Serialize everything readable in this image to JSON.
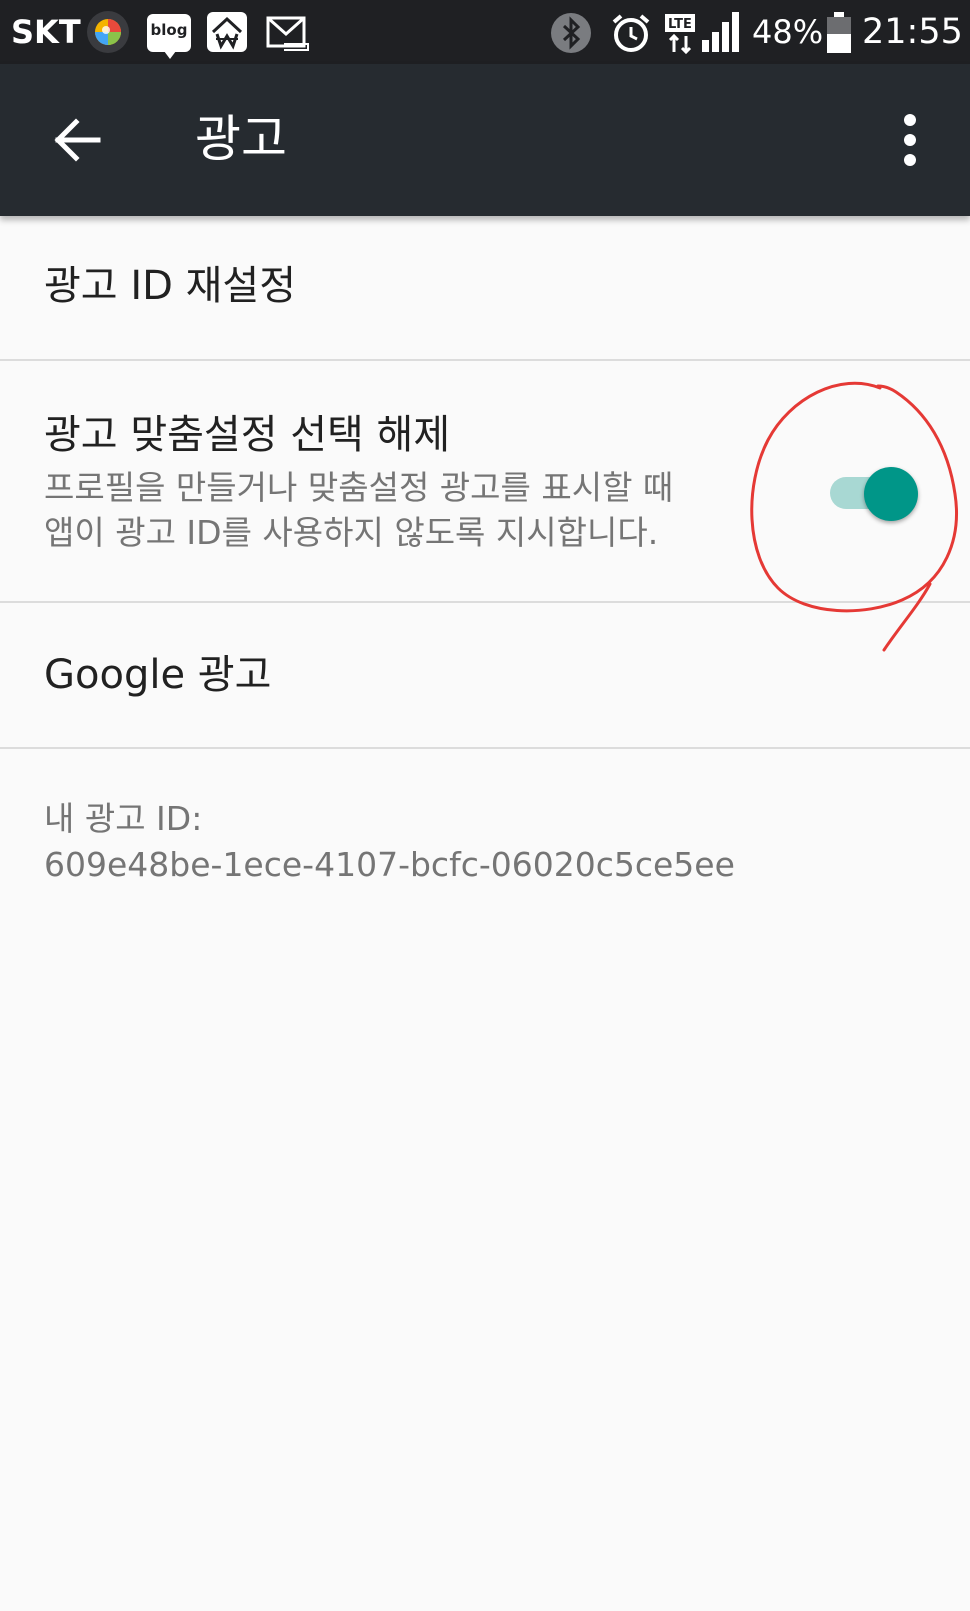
{
  "status_bar": {
    "carrier": "SKT",
    "blog_icon_label": "blog",
    "battery_percent": "48%",
    "network_type": "LTE",
    "time": "21:55",
    "icons": [
      "gallery-app-icon",
      "blog-icon",
      "won-app-icon",
      "mail-icon",
      "bluetooth-icon",
      "alarm-icon",
      "lte-icon",
      "signal-icon",
      "battery-icon"
    ]
  },
  "app_bar": {
    "title": "광고",
    "icons": [
      "back-arrow-icon",
      "more-vert-icon"
    ]
  },
  "settings": {
    "reset_id": {
      "title": "광고 ID 재설정"
    },
    "opt_out": {
      "title": "광고 맞춤설정 선택 해제",
      "summary_line1": "프로필을 만들거나 맞춤설정 광고를 표시할 때",
      "summary_line2": "앱이 광고 ID를 사용하지 않도록 지시합니다.",
      "toggle_on": true
    },
    "google_ads": {
      "title": "Google 광고"
    }
  },
  "ad_id": {
    "label": "내 광고 ID:",
    "value": "609e48be-1ece-4107-bcfc-06020c5ce5ee"
  },
  "colors": {
    "status_bar_bg": "#1f2023",
    "app_bar_bg": "#262b30",
    "page_bg": "#fafafa",
    "accent_teal": "#009688",
    "toggle_track": "#a8d8d3",
    "annotation_red": "#e53935"
  }
}
